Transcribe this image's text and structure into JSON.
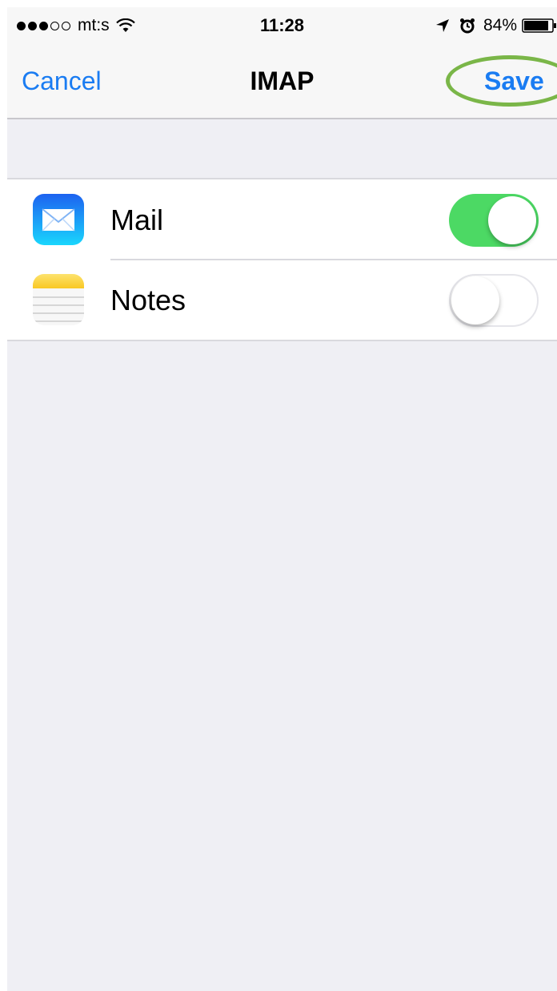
{
  "status_bar": {
    "carrier": "mt:s",
    "time": "11:28",
    "battery_percent": "84%",
    "signal_bars_filled": 3,
    "signal_bars_total": 5
  },
  "nav": {
    "cancel_label": "Cancel",
    "title": "IMAP",
    "save_label": "Save"
  },
  "list": {
    "items": [
      {
        "label": "Mail",
        "icon": "mail-icon",
        "enabled": true
      },
      {
        "label": "Notes",
        "icon": "notes-icon",
        "enabled": false
      }
    ]
  },
  "colors": {
    "accent": "#1a7cf2",
    "toggle_on": "#4cd964",
    "highlight": "#7ab648",
    "background": "#efeff4"
  }
}
